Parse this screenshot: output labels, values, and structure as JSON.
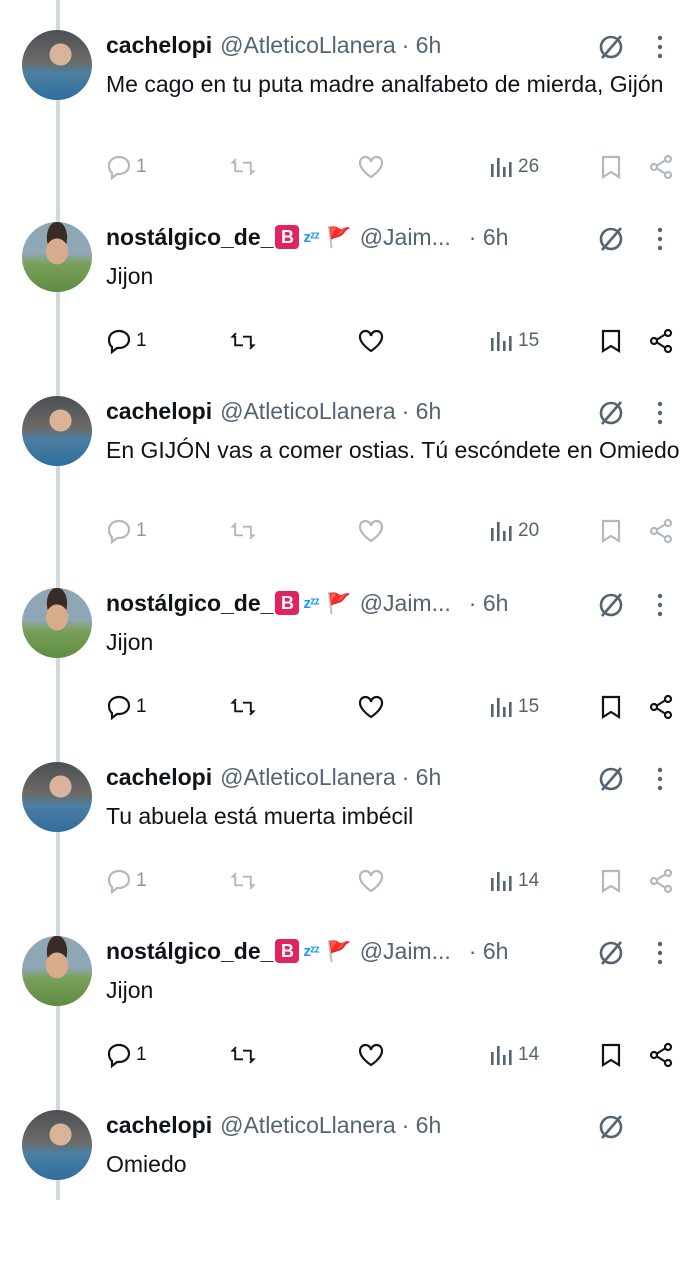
{
  "colors": {
    "text": "#0f1419",
    "secondary": "#536471",
    "thread_line": "#cfd9de",
    "flag": "#e0245e",
    "zzz": "#1d9bf0"
  },
  "users": {
    "cachelopi": {
      "name": "cachelopi",
      "handle": "@AtleticoLlanera"
    },
    "nostalgico": {
      "name": "nostálgico_de_",
      "badge": "B",
      "zzz": "zᶻᶻ",
      "flag": "🚩",
      "handle": "@Jaim..."
    }
  },
  "tweets": [
    {
      "user": "cachelopi",
      "time": "· 6h",
      "text": "Me cago en tu puta madre analfabeto de mierda, Gijón",
      "replies": "1",
      "views": "26"
    },
    {
      "user": "nostalgico",
      "time": "· 6h",
      "text": "Jijon",
      "replies": "1",
      "views": "15"
    },
    {
      "user": "cachelopi",
      "time": "· 6h",
      "text": "En GIJÓN vas a comer ostias. Tú escóndete en Omiedo",
      "replies": "1",
      "views": "20"
    },
    {
      "user": "nostalgico",
      "time": "· 6h",
      "text": "Jijon",
      "replies": "1",
      "views": "15"
    },
    {
      "user": "cachelopi",
      "time": "· 6h",
      "text": "Tu abuela está muerta imbécil",
      "replies": "1",
      "views": "14"
    },
    {
      "user": "nostalgico",
      "time": "· 6h",
      "text": "Jijon",
      "replies": "1",
      "views": "14"
    },
    {
      "user": "cachelopi",
      "time": "· 6h",
      "text": "Omiedo"
    }
  ],
  "icons": {
    "reply": "reply-icon",
    "retweet": "retweet-icon",
    "like": "heart-icon",
    "views": "views-icon",
    "bookmark": "bookmark-icon",
    "share": "share-icon",
    "mute": "mute-icon",
    "more": "more-icon"
  }
}
